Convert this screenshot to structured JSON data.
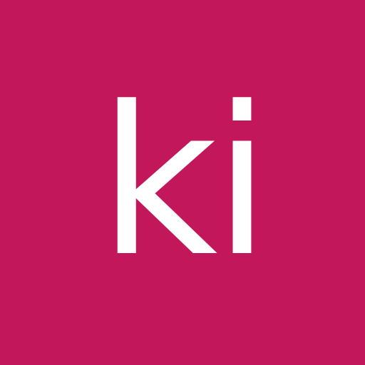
{
  "avatar": {
    "initials": "ki",
    "background_color": "#C2185B",
    "text_color": "#FFFFFF"
  }
}
